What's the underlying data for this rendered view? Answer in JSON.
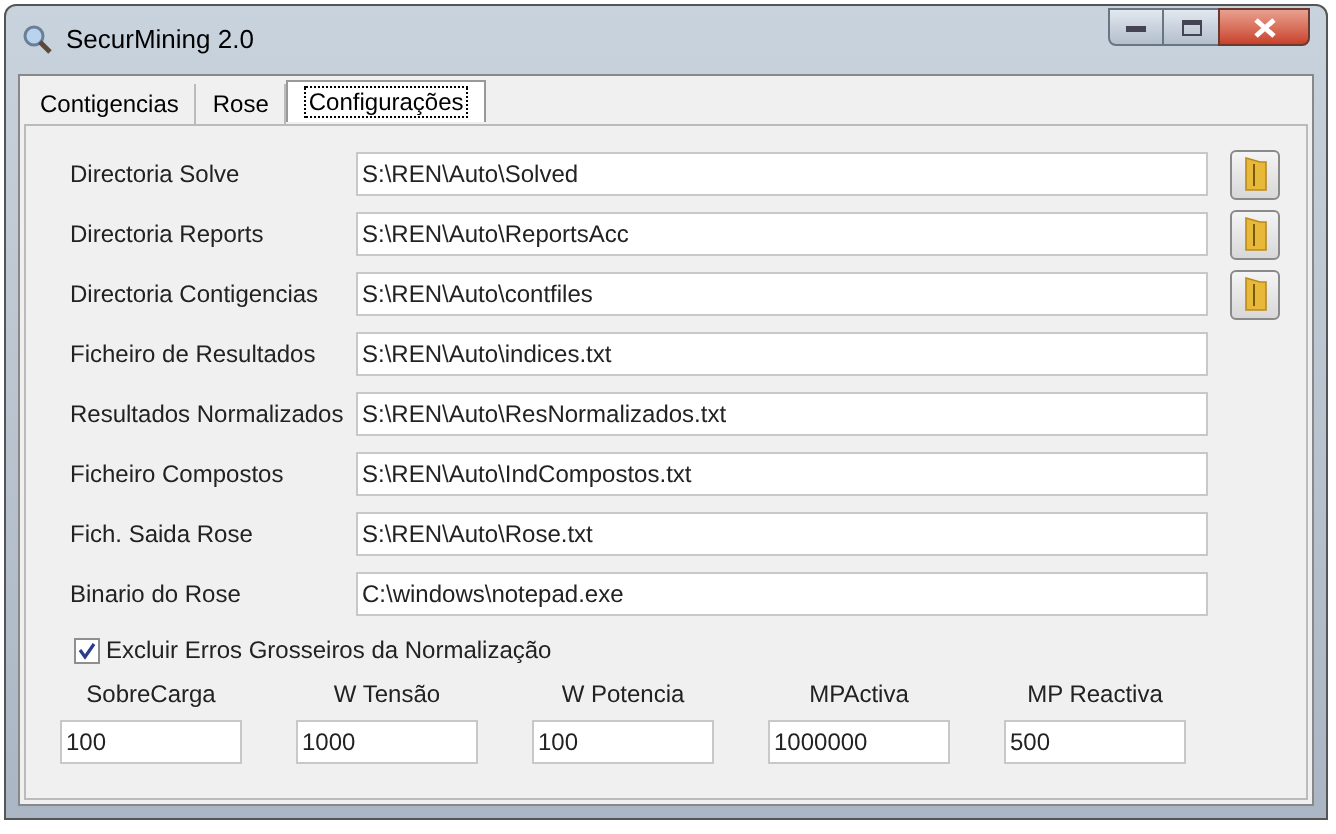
{
  "window": {
    "title": "SecurMining 2.0"
  },
  "tabs": [
    {
      "label": "Contigencias",
      "selected": false
    },
    {
      "label": "Rose",
      "selected": false
    },
    {
      "label": "Configurações",
      "selected": true
    }
  ],
  "paths": [
    {
      "label": "Directoria Solve",
      "value": "S:\\REN\\Auto\\Solved",
      "kind": "folder"
    },
    {
      "label": "Directoria Reports",
      "value": "S:\\REN\\Auto\\ReportsAcc",
      "kind": "folder"
    },
    {
      "label": "Directoria Contigencias",
      "value": "S:\\REN\\Auto\\contfiles",
      "kind": "folder"
    },
    {
      "label": "Ficheiro de Resultados",
      "value": "S:\\REN\\Auto\\indices.txt",
      "kind": "plain"
    },
    {
      "label": "Resultados Normalizados",
      "value": "S:\\REN\\Auto\\ResNormalizados.txt",
      "kind": "plain"
    },
    {
      "label": "Ficheiro Compostos",
      "value": "S:\\REN\\Auto\\IndCompostos.txt",
      "kind": "plain"
    },
    {
      "label": "Fich. Saida Rose",
      "value": "S:\\REN\\Auto\\Rose.txt",
      "kind": "plain"
    },
    {
      "label": "Binario do Rose",
      "value": "C:\\windows\\notepad.exe",
      "kind": "plain"
    }
  ],
  "exclude_option": {
    "label": "Excluir Erros Grosseiros da Normalização",
    "checked": true
  },
  "weights": [
    {
      "label": "SobreCarga",
      "value": "100"
    },
    {
      "label": "W Tensão",
      "value": "1000"
    },
    {
      "label": "W Potencia",
      "value": "100"
    },
    {
      "label": "MPActiva",
      "value": "1000000"
    },
    {
      "label": "MP Reactiva",
      "value": "500"
    }
  ]
}
